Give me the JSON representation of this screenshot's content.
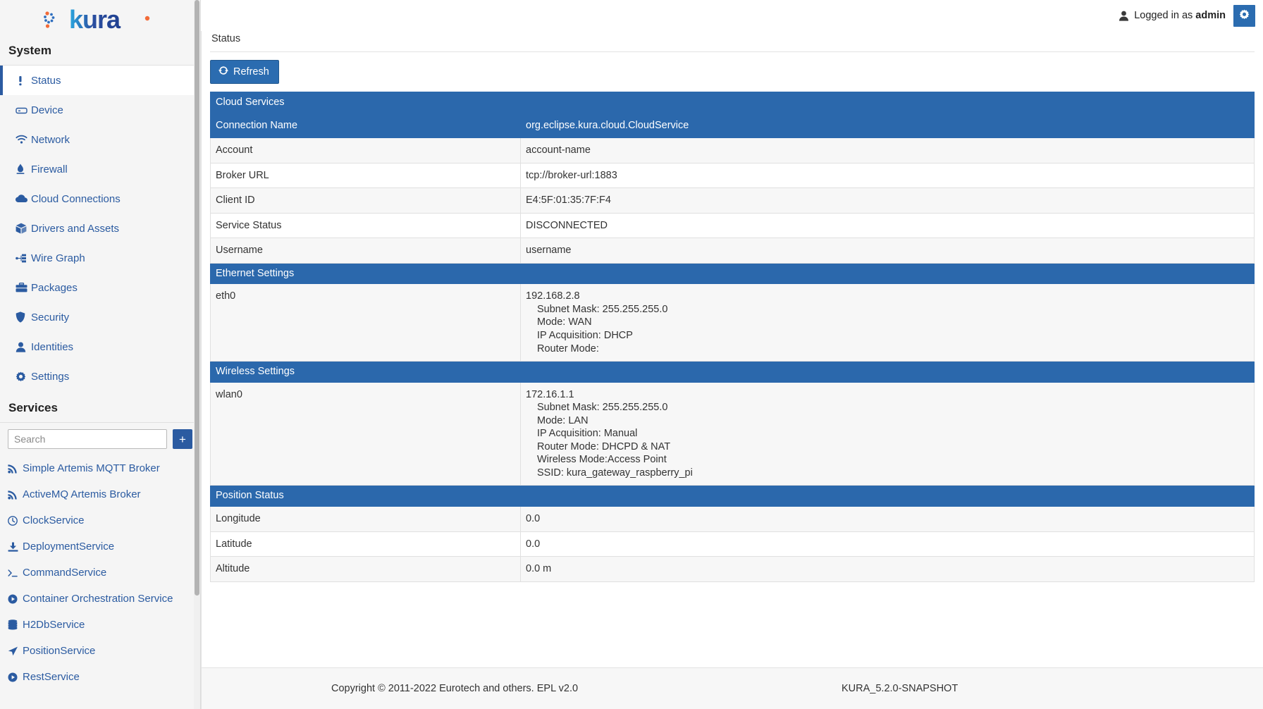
{
  "brand": {
    "name": "kura",
    "accent": "#2b5ba1",
    "dot_accent": "#f26b38"
  },
  "sidebar": {
    "system_heading": "System",
    "services_heading": "Services",
    "search": {
      "placeholder": "Search",
      "value": ""
    },
    "add_label": "+",
    "system_items": [
      {
        "label": "Status",
        "icon": "exclamation-icon",
        "active": true
      },
      {
        "label": "Device",
        "icon": "device-icon",
        "active": false
      },
      {
        "label": "Network",
        "icon": "wifi-icon",
        "active": false
      },
      {
        "label": "Firewall",
        "icon": "firewall-icon",
        "active": false
      },
      {
        "label": "Cloud Connections",
        "icon": "cloud-icon",
        "active": false
      },
      {
        "label": "Drivers and Assets",
        "icon": "box-icon",
        "active": false
      },
      {
        "label": "Wire Graph",
        "icon": "wire-graph-icon",
        "active": false
      },
      {
        "label": "Packages",
        "icon": "briefcase-icon",
        "active": false
      },
      {
        "label": "Security",
        "icon": "shield-icon",
        "active": false
      },
      {
        "label": "Identities",
        "icon": "user-icon",
        "active": false
      },
      {
        "label": "Settings",
        "icon": "gear-icon",
        "active": false
      }
    ],
    "service_items": [
      {
        "label": "Simple Artemis MQTT Broker",
        "icon": "rss-icon"
      },
      {
        "label": "ActiveMQ Artemis Broker",
        "icon": "rss-icon"
      },
      {
        "label": "ClockService",
        "icon": "clock-icon"
      },
      {
        "label": "DeploymentService",
        "icon": "download-icon"
      },
      {
        "label": "CommandService",
        "icon": "terminal-icon"
      },
      {
        "label": "Container Orchestration Service",
        "icon": "play-circle-icon"
      },
      {
        "label": "H2DbService",
        "icon": "database-icon"
      },
      {
        "label": "PositionService",
        "icon": "location-arrow-icon"
      },
      {
        "label": "RestService",
        "icon": "play-circle-icon"
      }
    ]
  },
  "topbar": {
    "logged_in_prefix": "Logged in as",
    "username": "admin",
    "user_icon": "user-icon",
    "gear_icon": "gear-icon"
  },
  "page": {
    "title": "Status",
    "refresh_label": "Refresh",
    "refresh_icon": "refresh-icon"
  },
  "table": {
    "sections": [
      {
        "heading": "Cloud Services",
        "heading_value": "",
        "rows": [
          {
            "label": "Connection Name",
            "value": "org.eclipse.kura.cloud.CloudService",
            "style": "header"
          },
          {
            "label": "Account",
            "value": "account-name",
            "style": "alt"
          },
          {
            "label": "Broker URL",
            "value": "tcp://broker-url:1883",
            "style": "plain"
          },
          {
            "label": "Client ID",
            "value": "E4:5F:01:35:7F:F4",
            "style": "alt"
          },
          {
            "label": "Service Status",
            "value": "DISCONNECTED",
            "style": "plain"
          },
          {
            "label": "Username",
            "value": "username",
            "style": "alt"
          }
        ]
      },
      {
        "heading": "Ethernet Settings",
        "heading_value": "",
        "rows": [
          {
            "label": "eth0",
            "value": "192.168.2.8",
            "details": [
              "Subnet Mask: 255.255.255.0",
              "Mode: WAN",
              "IP Acquisition: DHCP",
              "Router Mode:"
            ],
            "style": "alt"
          }
        ]
      },
      {
        "heading": "Wireless Settings",
        "heading_value": "",
        "rows": [
          {
            "label": "wlan0",
            "value": "172.16.1.1",
            "details": [
              "Subnet Mask: 255.255.255.0",
              "Mode: LAN",
              "IP Acquisition: Manual",
              "Router Mode: DHCPD & NAT",
              "Wireless Mode:Access Point",
              "SSID: kura_gateway_raspberry_pi"
            ],
            "style": "alt"
          }
        ]
      },
      {
        "heading": "Position Status",
        "heading_value": "",
        "rows": [
          {
            "label": "Longitude",
            "value": "0.0",
            "style": "alt"
          },
          {
            "label": "Latitude",
            "value": "0.0",
            "style": "plain"
          },
          {
            "label": "Altitude",
            "value": "0.0 m",
            "style": "alt"
          }
        ]
      }
    ]
  },
  "footer": {
    "copyright": "Copyright © 2011-2022 Eurotech and others. EPL v2.0",
    "version": "KURA_5.2.0-SNAPSHOT"
  }
}
